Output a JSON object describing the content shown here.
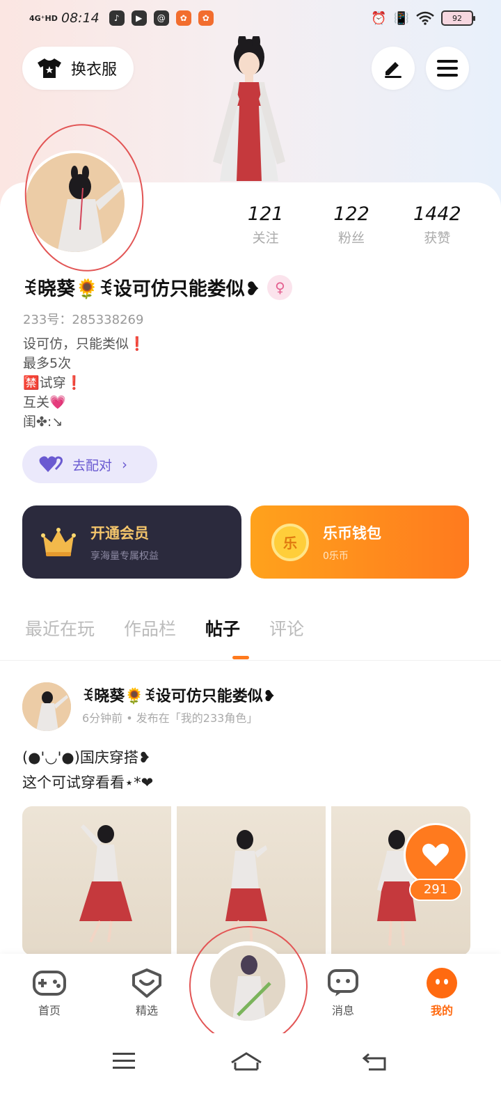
{
  "status_bar": {
    "network": "4G⁺HD",
    "time": "08:14",
    "battery": "92",
    "app_icons": [
      "music-icon",
      "video-icon",
      "message-icon",
      "app-icon",
      "app-icon"
    ]
  },
  "header": {
    "change_clothes_label": "换衣服",
    "edit_icon": "pen-icon",
    "menu_icon": "menu-icon"
  },
  "profile": {
    "stats": [
      {
        "num": "121",
        "label": "关注"
      },
      {
        "num": "122",
        "label": "粉丝"
      },
      {
        "num": "1442",
        "label": "获赞"
      }
    ],
    "nickname": "ꉂ晓葵🌻ꉂ设可仿只能娄似❥",
    "gender_symbol": "♀",
    "uid": "233号：285338269",
    "bio": [
      "设可仿，只能类似❗",
      "最多5次",
      "🈲试穿❗",
      "互关💗",
      "闺✤:↘"
    ],
    "match_label": "去配对"
  },
  "cards": {
    "vip_title": "开通会员",
    "vip_sub": "享海量专属权益",
    "wallet_title": "乐币钱包",
    "wallet_sub": "0乐币",
    "coin_char": "乐"
  },
  "tabs": [
    "最近在玩",
    "作品栏",
    "帖子",
    "评论"
  ],
  "active_tab": 2,
  "post": {
    "author": "ꉂ晓葵🌻ꉂ设可仿只能娄似❥",
    "meta": "6分钟前 • 发布在「我的233角色」",
    "text_line1": "(●'◡'●)国庆穿搭❥",
    "text_line2": "这个可试穿看看⋆*❤",
    "like_count": "291"
  },
  "bottom_nav": {
    "items": [
      {
        "label": "首页",
        "icon": "gamepad-icon"
      },
      {
        "label": "精选",
        "icon": "heart-chat-icon"
      },
      {
        "label": "消息",
        "icon": "message-icon"
      },
      {
        "label": "我的",
        "icon": "face-icon"
      }
    ],
    "active_index": 3
  },
  "colors": {
    "accent": "#ff7a1e",
    "vip_bg": "#2b2a3d",
    "match_text": "#6a5ad1"
  }
}
